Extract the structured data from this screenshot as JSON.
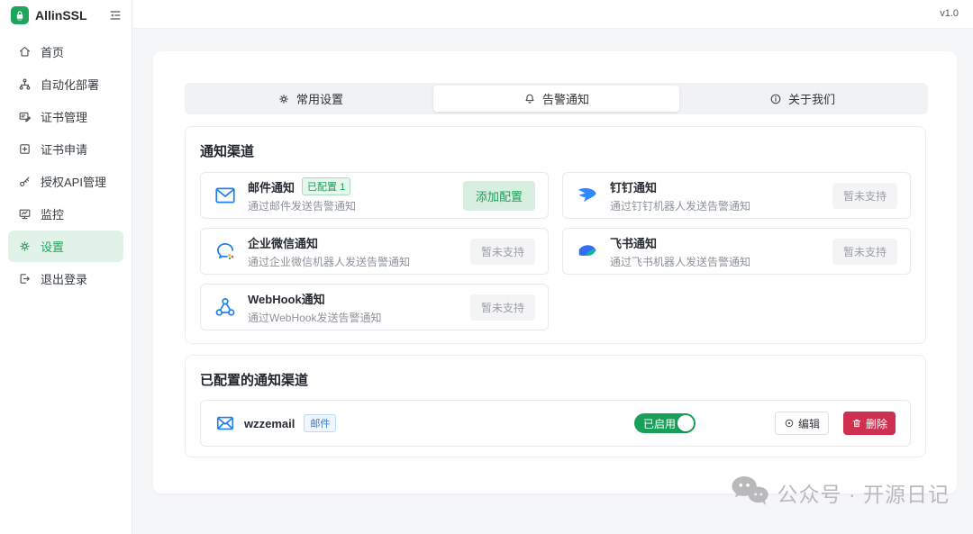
{
  "app": {
    "name": "AllinSSL",
    "version": "v1.0"
  },
  "colors": {
    "accent_green": "#18a058",
    "brand_blue": "#2080f0",
    "danger_red": "#d03050",
    "active_bg": "#e1f3e8"
  },
  "sidebar": {
    "items": [
      {
        "label": "首页",
        "icon": "home-icon"
      },
      {
        "label": "自动化部署",
        "icon": "deploy-icon"
      },
      {
        "label": "证书管理",
        "icon": "cert-manage-icon"
      },
      {
        "label": "证书申请",
        "icon": "cert-apply-icon"
      },
      {
        "label": "授权API管理",
        "icon": "api-auth-icon"
      },
      {
        "label": "监控",
        "icon": "monitor-icon"
      },
      {
        "label": "设置",
        "icon": "settings-icon",
        "active": true
      },
      {
        "label": "退出登录",
        "icon": "logout-icon"
      }
    ]
  },
  "tabs": [
    {
      "label": "常用设置",
      "icon": "gear-icon",
      "active": false
    },
    {
      "label": "告警通知",
      "icon": "bell-icon",
      "active": true
    },
    {
      "label": "关于我们",
      "icon": "info-icon",
      "active": false
    }
  ],
  "channels": {
    "title": "通知渠道",
    "cards": [
      {
        "title": "邮件通知",
        "badge": "已配置 1",
        "desc": "通过邮件发送告警通知",
        "action": "添加配置",
        "action_type": "primary",
        "icon": "email-icon"
      },
      {
        "title": "钉钉通知",
        "desc": "通过钉钉机器人发送告警通知",
        "action": "暂未支持",
        "action_type": "disabled",
        "icon": "dingtalk-icon"
      },
      {
        "title": "企业微信通知",
        "desc": "通过企业微信机器人发送告警通知",
        "action": "暂未支持",
        "action_type": "disabled",
        "icon": "wecom-icon"
      },
      {
        "title": "飞书通知",
        "desc": "通过飞书机器人发送告警通知",
        "action": "暂未支持",
        "action_type": "disabled",
        "icon": "feishu-icon"
      },
      {
        "title": "WebHook通知",
        "desc": "通过WebHook发送告警通知",
        "action": "暂未支持",
        "action_type": "disabled",
        "icon": "webhook-icon"
      }
    ]
  },
  "configured": {
    "title": "已配置的通知渠道",
    "rows": [
      {
        "name": "wzzemail",
        "type_badge": "邮件",
        "toggle_label": "已启用",
        "toggle_on": true,
        "edit_label": "编辑",
        "delete_label": "删除",
        "icon": "email-icon"
      }
    ]
  },
  "watermark": {
    "text": "公众号 · 开源日记",
    "icon": "wechat-icon"
  }
}
